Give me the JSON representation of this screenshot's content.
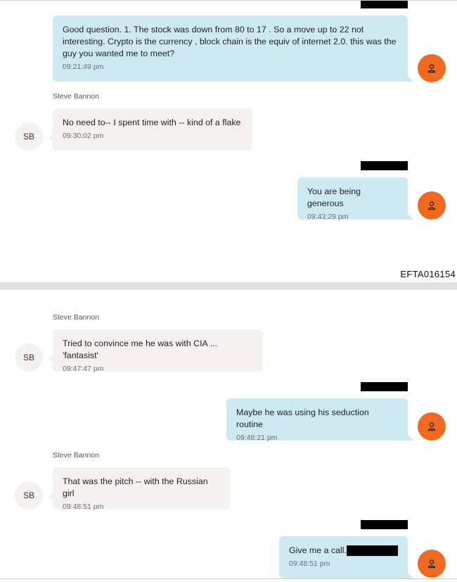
{
  "document": {
    "footer_id": "EFTA016154"
  },
  "contacts": {
    "other_name": "Steve Bannon",
    "other_initials": "SB",
    "me_icon": "person-icon"
  },
  "colors": {
    "outgoing_bubble": "#cde9f1",
    "incoming_bubble": "#f3f2ee",
    "avatar_me": "#ef6a1f",
    "redaction": "#000000"
  },
  "messages": [
    {
      "direction": "outgoing",
      "text": "Good question.  1.  The stock was down from 80  to 17 .  So a move up to 22 not interesting.   Crypto is the currency , block chain is the equiv  of internet 2.0.   this was the guy you wanted me to meet?",
      "time": "09:21:49 pm"
    },
    {
      "direction": "incoming",
      "sender": "Steve Bannon",
      "text": "No need to-- I spent time with -- kind of a flake",
      "time": "09:30:02 pm"
    },
    {
      "direction": "outgoing",
      "text": "You are being generous",
      "time": "09:43:29 pm"
    },
    {
      "direction": "incoming",
      "sender": "Steve Bannon",
      "text": "Tried to convince me he was with CIA ... 'fantasist'",
      "time": "09:47:47 pm"
    },
    {
      "direction": "outgoing",
      "text": "Maybe he was using his seduction routine",
      "time": "09:48:21 pm"
    },
    {
      "direction": "incoming",
      "sender": "Steve Bannon",
      "text": "That was the pitch -- with the Russian girl",
      "time": "09:48:51 pm"
    },
    {
      "direction": "outgoing",
      "text": "Give me a call.",
      "time": "09:48:51 pm"
    }
  ]
}
